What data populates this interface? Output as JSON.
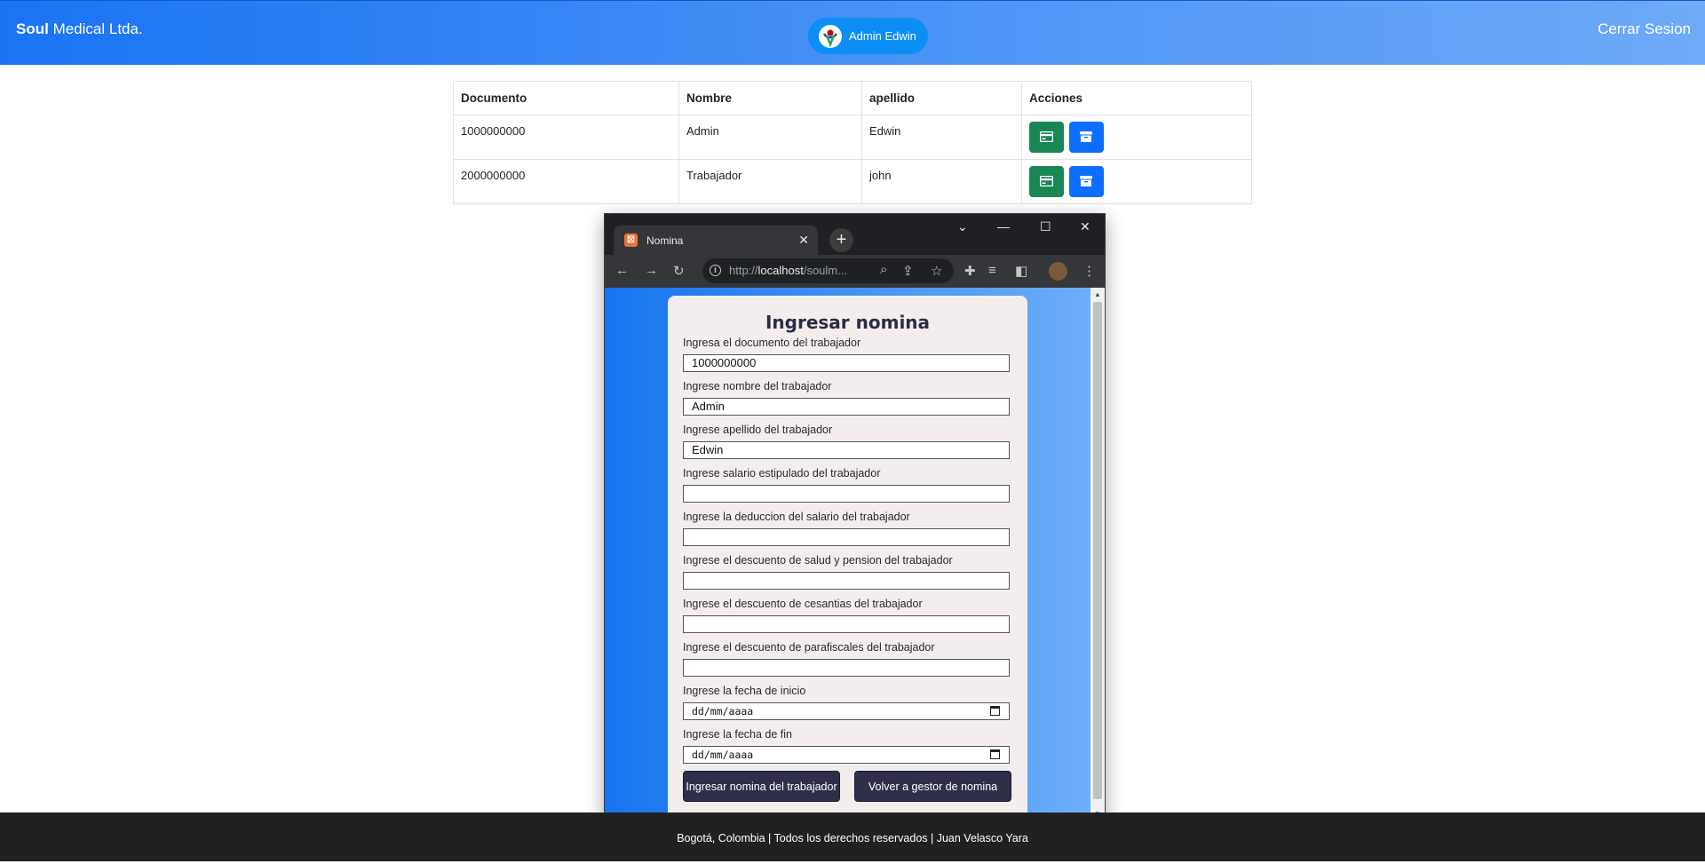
{
  "navbar": {
    "brand_bold": "Soul",
    "brand_rest": " Medical Ltda.",
    "user_name": "Admin Edwin",
    "logout_label": "Cerrar Sesion"
  },
  "table": {
    "headers": [
      "Documento",
      "Nombre",
      "apellido",
      "Acciones"
    ],
    "rows": [
      {
        "documento": "1000000000",
        "nombre": "Admin",
        "apellido": "Edwin"
      },
      {
        "documento": "2000000000",
        "nombre": "Trabajador",
        "apellido": "john"
      }
    ],
    "action_icons": [
      "credit-card-icon",
      "archive-icon"
    ],
    "colors": {
      "green": "#198754",
      "blue": "#0d6efd"
    }
  },
  "popup": {
    "tab_title": "Nomina",
    "url_prefix": "http://",
    "url_host": "localhost",
    "url_rest": "/soulm...",
    "form": {
      "title": "Ingresar nomina",
      "fields": [
        {
          "label": "Ingresa el documento del trabajador",
          "value": ""
        },
        {
          "label": "Ingrese nombre del trabajador",
          "value": ""
        },
        {
          "label": "Ingrese apellido del trabajador",
          "value": ""
        },
        {
          "label": "Ingrese salario estipulado del trabajador",
          "value": ""
        },
        {
          "label": "Ingrese la deduccion del salario del trabajador",
          "value": ""
        },
        {
          "label": "Ingrese el descuento de salud y pension del trabajador",
          "value": ""
        },
        {
          "label": "Ingrese el descuento de cesantias del trabajador",
          "value": ""
        },
        {
          "label": "Ingrese el descuento de parafiscales del trabajador",
          "value": ""
        },
        {
          "label": "Ingrese la fecha de inicio",
          "value": "dd/mm/aaaa"
        },
        {
          "label": "Ingrese la fecha de fin",
          "value": "dd/mm/aaaa"
        }
      ],
      "prefill": [
        "1000000000",
        "Admin",
        "Edwin"
      ],
      "submit_label": "Ingresar nomina del trabajador",
      "back_label": "Volver a gestor de nomina"
    }
  },
  "footer": {
    "text": "Bogotá, Colombia | Todos los derechos reservados | Juan Velasco Yara"
  }
}
